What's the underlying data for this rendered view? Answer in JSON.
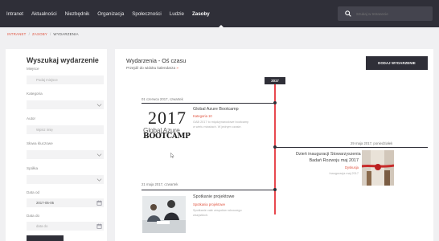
{
  "nav": {
    "items": [
      "Intranet",
      "Aktualności",
      "Niezbędnik",
      "Organizacja",
      "Społeczności",
      "Ludzie",
      "Zasoby"
    ],
    "active_index": 6,
    "search_placeholder": "Szukaj w Intranecie"
  },
  "breadcrumb": {
    "items": [
      "INTRANET",
      "ZASOBY",
      "WYDARZENIA"
    ],
    "separator": "/"
  },
  "sidebar": {
    "title": "Wyszukaj wydarzenie",
    "fields": [
      {
        "label": "Miejsce",
        "text": "Podaj miejsce",
        "icon": ""
      },
      {
        "label": "Kategoria",
        "text": "",
        "icon": "chevron-icon"
      },
      {
        "label": "Autor",
        "text": "Wpisz imię",
        "icon": ""
      },
      {
        "label": "Słowa kluczowe",
        "text": "",
        "icon": "chevron-icon"
      },
      {
        "label": "Spółka",
        "text": "",
        "icon": "chevron-icon"
      },
      {
        "label": "Data od",
        "text": "2017-05-05",
        "icon": "calendar-icon"
      },
      {
        "label": "Data do",
        "text": "data do",
        "icon": "calendar-icon"
      }
    ]
  },
  "main": {
    "title": "Wydarzenia - Oś czasu",
    "subtitle": "Przejdź do widoku kalendarza",
    "subtitle_arrow": "»",
    "add_button": "DODAJ WYDARZENIE",
    "timeline_year": "2017",
    "events": [
      {
        "date": "01 czerwca 2017, czwartek",
        "title": "Global Azure Bootcamp",
        "category": "Kategoria 10",
        "desc": [
          "GAB 2017 to międzynarodowe bootcamp",
          "w wielu miastach. W jednym czasie."
        ],
        "image_year": "2017",
        "image_line1": "Global Azure",
        "image_line2": "BOOTCAMP"
      },
      {
        "date": "29 maja 2017, poniedziałek",
        "title_lines": [
          "Dzień inauguracji Stowarzyszenia",
          "Badań Rozwoju maj 2017"
        ],
        "category": "Dyskusja",
        "meta": "Inauguracja maj 2017"
      },
      {
        "date": "21 maja 2017, czwartek",
        "title": "Spotkanie projektowe",
        "category": "Spotkania projektowe",
        "desc": [
          "Spotkanie całe zespołów roboczego",
          "wszystkich."
        ]
      }
    ]
  },
  "colors": {
    "nav_bg": "#2f2f38",
    "accent": "#e0533f",
    "timeline": "#e8484e"
  }
}
